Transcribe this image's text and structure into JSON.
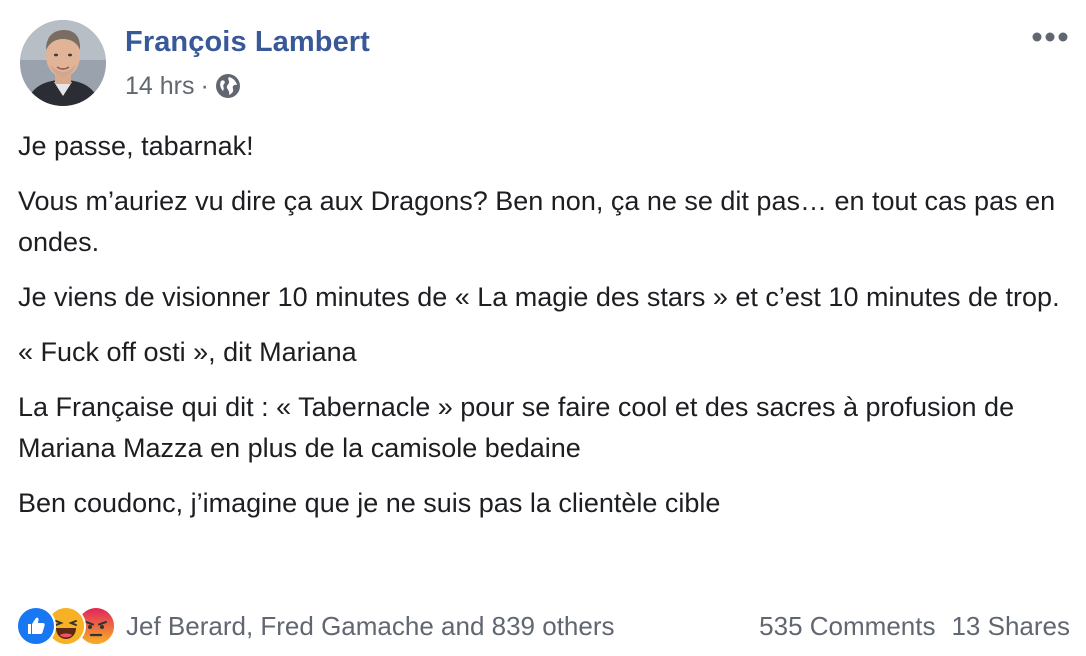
{
  "post": {
    "author": "François Lambert",
    "time": "14 hrs",
    "separator": "·",
    "privacy_icon": "globe-icon",
    "menu_icon": "more-horizontal-icon",
    "paragraphs": [
      "Je passe, tabarnak!",
      "Vous m’auriez vu dire ça aux Dragons? Ben non, ça ne se dit pas… en tout cas pas en ondes.",
      "Je viens de visionner 10 minutes de « La magie des stars » et c’est 10 minutes de trop.",
      "« Fuck off osti », dit Mariana",
      "La Française qui dit : « Tabernacle » pour se faire cool et des sacres à profusion de Mariana Mazza en plus de la camisole bedaine",
      "Ben coudonc, j’imagine que je ne suis pas la clientèle cible"
    ]
  },
  "footer": {
    "reaction_icons": [
      "like-icon",
      "haha-icon",
      "angry-icon"
    ],
    "reacted_by": "Jef Berard, Fred Gamache and 839 others",
    "comments": "535 Comments",
    "shares": "13 Shares"
  },
  "colors": {
    "author_link": "#385898",
    "meta_text": "#616770",
    "body_text": "#1c1e21",
    "like_blue": "#1877f2",
    "haha_yellow": "#f7b125",
    "angry_orange": "#e9710f"
  }
}
